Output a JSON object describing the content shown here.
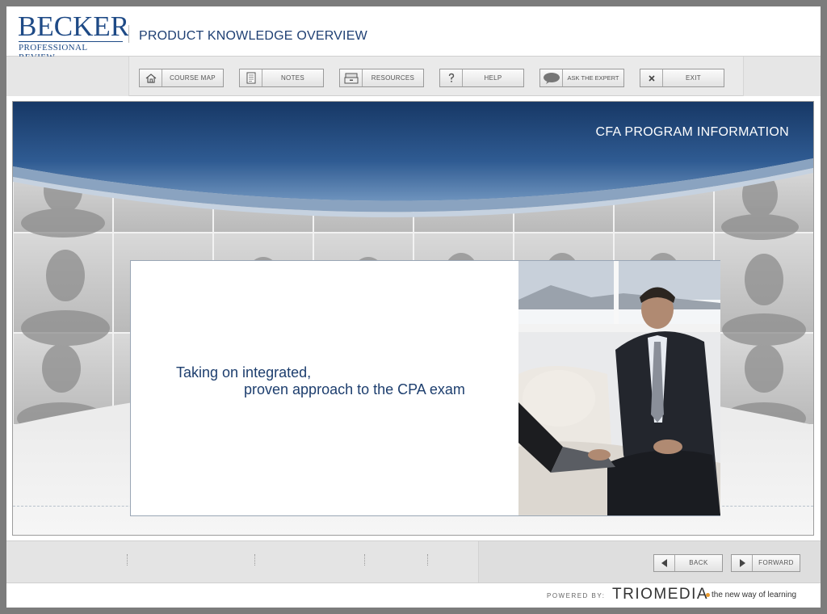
{
  "header": {
    "logo_main": "Becker",
    "logo_sub": "Professional Review",
    "course_title": "PRODUCT KNOWLEDGE OVERVIEW"
  },
  "toolbar": {
    "buttons": [
      {
        "label": "COURSE MAP",
        "icon": "home-icon"
      },
      {
        "label": "NOTES",
        "icon": "document-icon"
      },
      {
        "label": "RESOURCES",
        "icon": "file-cabinet-icon"
      },
      {
        "label": "HELP",
        "icon": "question-icon"
      },
      {
        "label": "ASK THE EXPERT",
        "icon": "speech-bubble-icon"
      },
      {
        "label": "EXIT",
        "icon": "close-icon"
      }
    ]
  },
  "stage": {
    "section_title": "CFA PROGRAM INFORMATION",
    "headline_line1": "Taking on integrated,",
    "headline_line2": "proven approach to the CPA exam",
    "photo": "businessman-with-laptop-image"
  },
  "nav": {
    "back_label": "BACK",
    "forward_label": "FORWARD",
    "back_icon": "triangle-left-icon",
    "forward_icon": "triangle-right-icon"
  },
  "footer": {
    "powered_by": "POWERED BY:",
    "brand": "TRIOMEDIA",
    "tagline": "the new way of learning"
  },
  "colors": {
    "brand_blue": "#1e4a86",
    "banner_dark": "#1d3f70",
    "headline": "#1d3e6e",
    "accent_orange": "#e89a2e"
  }
}
